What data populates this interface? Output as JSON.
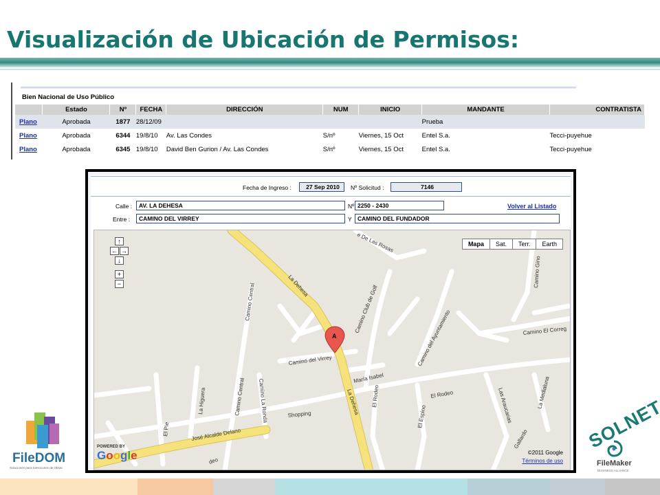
{
  "slide": {
    "title": "Visualización de Ubicación de Permisos:"
  },
  "table": {
    "section": "Bien Nacional de Uso Público",
    "headers": [
      "Estado",
      "Nº",
      "FECHA",
      "DIRECCIÓN",
      "NUM",
      "INICIO",
      "MANDANTE",
      "CONTRATISTA"
    ],
    "rows": [
      {
        "plano": "Plano",
        "estado": "Aprobada",
        "num": "1877",
        "fecha": "28/12/09",
        "direccion": "",
        "nro": "",
        "inicio": "",
        "mandante": "Prueba",
        "contratista": ""
      },
      {
        "plano": "Plano",
        "estado": "Aprobada",
        "num": "6344",
        "fecha": "19/8/10",
        "direccion": "Av. Las Condes",
        "nro": "S/nº",
        "inicio": "Viernes, 15 Oct",
        "mandante": "Entel S.a.",
        "contratista": "Tecci-puyehue"
      },
      {
        "plano": "Plano",
        "estado": "Aprobada",
        "num": "6345",
        "fecha": "19/8/10",
        "direccion": "David Ben Gurion / Av. Las Condes",
        "nro": "S/nº",
        "inicio": "Viernes, 15 Oct",
        "mandante": "Entel S.a.",
        "contratista": "Tecci-puyehue"
      }
    ]
  },
  "detail": {
    "fecha_ingreso_label": "Fecha de Ingreso :",
    "fecha_ingreso": "27 Sep 2010",
    "solicitud_label": "Nº Solicitud :",
    "solicitud": "7146",
    "calle_label": "Calle :",
    "calle": "AV. LA DEHESA",
    "numero_label": "Nº",
    "numero": "2250 - 2430",
    "entre_label": "Entre :",
    "entre": "CAMINO DEL VIRREY",
    "y_label": "Y",
    "y_calle": "CAMINO DEL FUNDADOR",
    "volver": "Volver al Listado"
  },
  "map": {
    "types": [
      "Mapa",
      "Sat.",
      "Terr.",
      "Earth"
    ],
    "active_type": "Mapa",
    "pan_up": "↑",
    "pan_left": "←",
    "pan_right": "→",
    "pan_down": "↓",
    "zoom_in": "+",
    "zoom_out": "−",
    "marker": "A",
    "streets": {
      "la_dehesa_1": "La Dehesa",
      "la_dehesa_2": "La Dehesa",
      "camino_central_1": "Camino Central",
      "camino_central_2": "Camino Central",
      "club_golf": "Camino Club de Golf",
      "las_rosas": "e De Las Rosas",
      "ginger": "Camino Gino",
      "virrey": "Camino del Virrey",
      "maria_isabel": "María Isabel",
      "ayuntamiento": "Camino del Ayuntamiento",
      "el_correg": "Camino El Correg",
      "el_rodeo": "El Rodeo",
      "el_rodeo_v": "El Rodeo",
      "el_espino": "El Espino",
      "las_araucarias": "Las Araucarias",
      "la_medialuna": "La Medialuna",
      "la_higuera": "La Higuera",
      "la_ronda": "Camino La Ronda",
      "shopping": "Shopping",
      "jose_alcalde": "José Alcalde Delano",
      "el_pie": "El Pie",
      "gallardo": "Gallardo",
      "deo": "deo"
    },
    "powered_by": "POWERED BY",
    "google": "Google",
    "copyright": "©2011 Google",
    "terms": "Términos de uso"
  },
  "logos": {
    "filedom": "FileDOM",
    "filedom_sub": "Soluciones para Direcciones de Obras",
    "solnet": "SOLNET",
    "filemaker": "FileMaker",
    "filemaker_sub": "BUSINESS ALLIANCE"
  },
  "colors": {
    "title": "#17766f",
    "road_major": "#f6e27a",
    "road_minor": "#ffffff",
    "map_bg": "#e9e6df"
  }
}
